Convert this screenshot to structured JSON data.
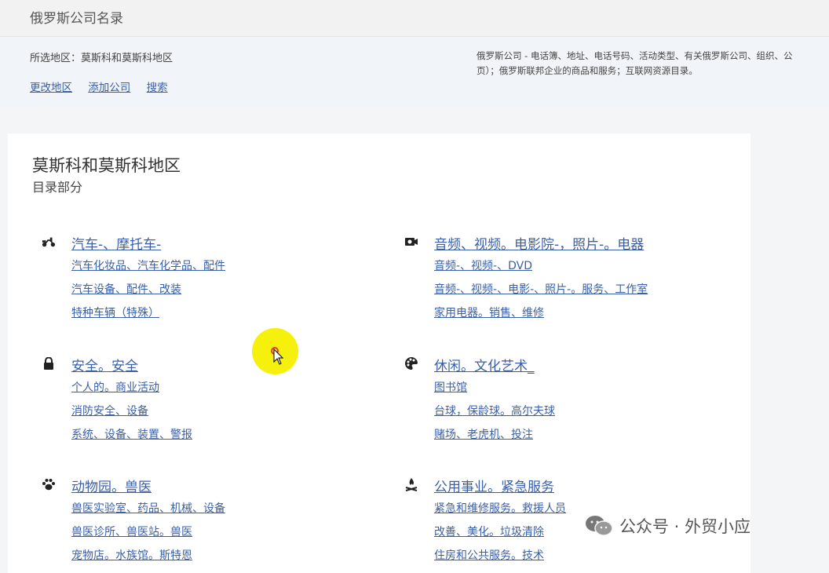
{
  "header": {
    "title": "俄罗斯公司名录"
  },
  "info": {
    "region_label": "所选地区：",
    "region_value": "莫斯科和莫斯科地区",
    "actions": [
      "更改地区",
      "添加公司",
      "搜索"
    ],
    "description_line1": "俄罗斯公司 - 电话簿、地址、电话号码、活动类型、有关俄罗斯公司、组织、公",
    "description_line2": "页）；俄罗斯联邦企业的商品和服务；互联网资源目录。"
  },
  "card": {
    "title": "莫斯科和莫斯科地区",
    "subtitle": "目录部分"
  },
  "categories": [
    {
      "icon": "scooter-icon",
      "title": "汽车-、摩托车-",
      "subs": [
        "汽车化妆品、汽车化学品、配件",
        "汽车设备、配件、改装",
        "特种车辆（特殊）"
      ]
    },
    {
      "icon": "camera-icon",
      "title": "音频、视频。电影院-，照片-。电器",
      "subs": [
        "音频-、视频-、DVD",
        "音频-、视频-、电影-、照片-。服务、工作室",
        "家用电器。销售、维修"
      ]
    },
    {
      "icon": "lock-icon",
      "title": "安全。安全",
      "subs": [
        "个人的。商业活动",
        "消防安全、设备",
        "系统、设备、装置、警报"
      ]
    },
    {
      "icon": "palette-icon",
      "title": "休闲。文化艺术_",
      "subs": [
        "图书馆",
        "台球，保龄球。高尔夫球",
        "赌场、老虎机、投注"
      ]
    },
    {
      "icon": "paw-icon",
      "title": "动物园。兽医",
      "subs": [
        "兽医实验室、药品、机械、设备",
        "兽医诊所、兽医站。兽医",
        "宠物店。水族馆。斯特恩"
      ]
    },
    {
      "icon": "campfire-icon",
      "title": "公用事业。紧急服务",
      "subs": [
        "紧急和维修服务。救援人员",
        "改善、美化。垃圾清除",
        "住房和公共服务。技术"
      ]
    }
  ],
  "watermark": {
    "text": "公众号 · 外贸小应"
  },
  "colors": {
    "link": "#3a5fa8",
    "cursor_highlight": "#f5f00c"
  }
}
